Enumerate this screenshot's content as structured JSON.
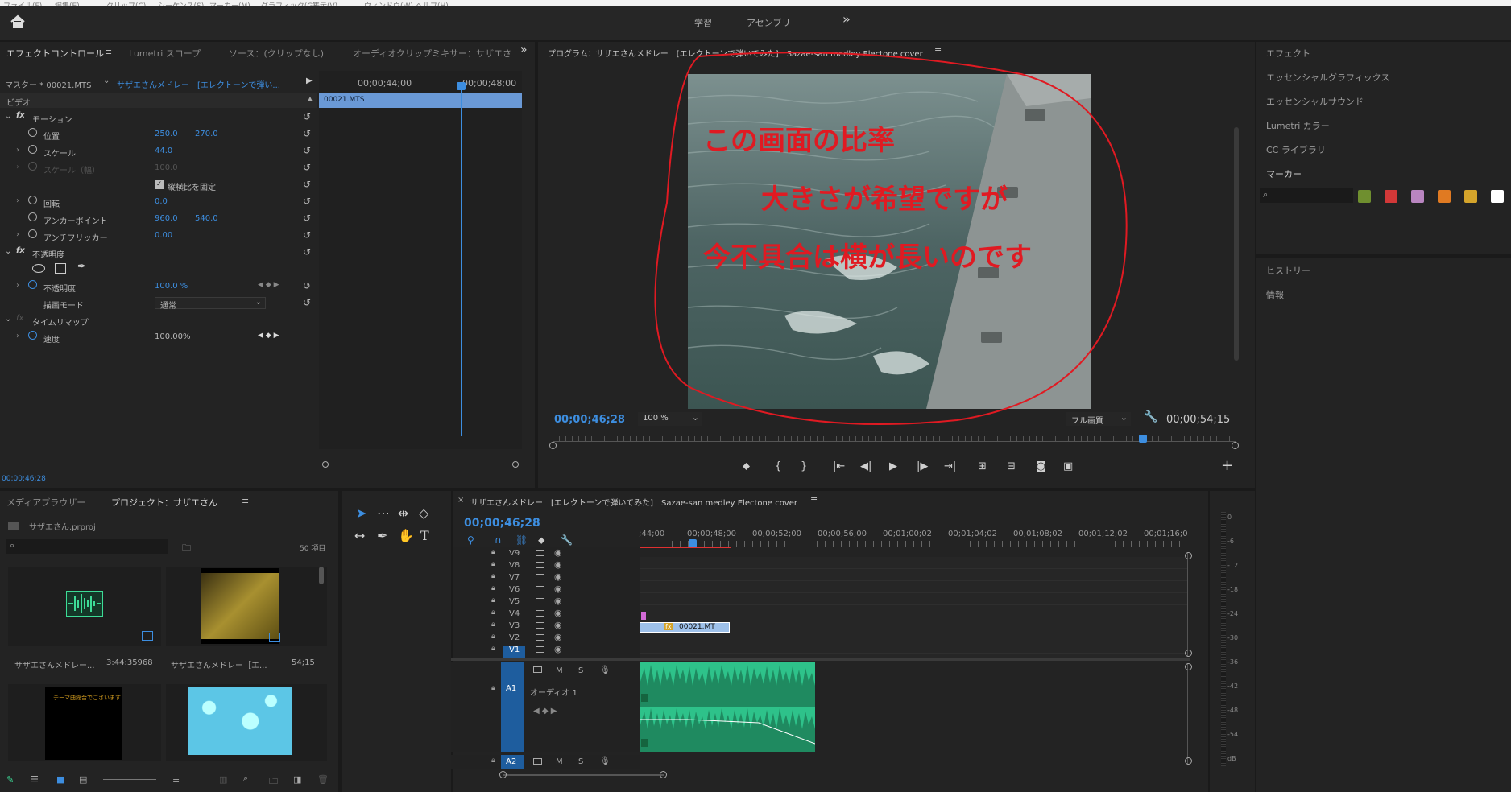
{
  "menubar": {
    "items": [
      "ファイル(F)",
      "編集(E)",
      "クリップ(C)",
      "シーケンス(S)",
      "マーカー(M)",
      "グラフィック(G)",
      "表示(V)",
      "ウィンドウ(W)",
      "ヘルプ(H)"
    ]
  },
  "workspace": {
    "learn": "学習",
    "assembly": "アセンブリ",
    "more": "»"
  },
  "effect_controls": {
    "tabs": [
      "エフェクトコントロール",
      "Lumetri スコープ",
      "ソース：(クリップなし)",
      "オーディオクリップミキサー：サザエさ"
    ],
    "master": "マスター * 00021.MTS",
    "sequence": "サザエさんメドレー　[エレクトーンで弾い...",
    "video_header": "ビデオ",
    "timecode_start": "00;00;44;00",
    "timecode_end": "00;00;48;00",
    "clip": "00021.MTS",
    "motion": "モーション",
    "position_label": "位置",
    "position_x": "250.0",
    "position_y": "270.0",
    "scale_label": "スケール",
    "scale_value": "44.0",
    "scale_w_label": "スケール（幅）",
    "scale_w_value": "100.0",
    "uniform_label": "縦横比を固定",
    "rotation_label": "回転",
    "rotation_value": "0.0",
    "anchor_label": "アンカーポイント",
    "anchor_x": "960.0",
    "anchor_y": "540.0",
    "flicker_label": "アンチフリッカー",
    "flicker_value": "0.00",
    "opacity_section": "不透明度",
    "opacity_label": "不透明度",
    "opacity_value": "100.0 %",
    "blend_label": "描画モード",
    "blend_value": "通常",
    "timeremap": "タイムリマップ",
    "speed_label": "速度",
    "speed_value": "100.00%",
    "bottom_tc": "00;00;46;28"
  },
  "program": {
    "title": "プログラム：サザエさんメドレー　[エレクトーンで弾いてみた]　Sazae-san medley Electone cover",
    "tc": "00;00;46;28",
    "zoom": "100 %",
    "quality": "フル画質",
    "duration": "00;00;54;15",
    "annotation": [
      "この画面の比率",
      "大きさが希望ですが",
      "今不具合は横が長いのです"
    ]
  },
  "right_panel": {
    "items": [
      "エフェクト",
      "エッセンシャルグラフィックス",
      "エッセンシャルサウンド",
      "Lumetri カラー",
      "CC ライブラリ",
      "マーカー"
    ],
    "history": "ヒストリー",
    "info": "情報",
    "swatches": [
      "#6f8f2f",
      "#d23838",
      "#b985c0",
      "#e07a22",
      "#d4a42b",
      "#ffffff"
    ]
  },
  "project": {
    "tabs": [
      "メディアブラウザー",
      "プロジェクト：サザエさん"
    ],
    "file": "サザエさん.prproj",
    "count": "50 項目",
    "items": [
      {
        "name": "サザエさんメドレー...",
        "dur": "3:44:35968"
      },
      {
        "name": "サザエさんメドレー［エ...",
        "dur": "54;15"
      }
    ],
    "black_text": "テーマ曲総合でございます"
  },
  "timeline": {
    "title": "サザエさんメドレー　[エレクトーンで弾いてみた]　Sazae-san medley Electone cover",
    "tc": "00;00;46;28",
    "ticks": [
      ";44;00",
      "00;00;48;00",
      "00;00;52;00",
      "00;00;56;00",
      "00;01;00;02",
      "00;01;04;02",
      "00;01;08;02",
      "00;01;12;02",
      "00;01;16;0"
    ],
    "video_tracks": [
      "V9",
      "V8",
      "V7",
      "V6",
      "V5",
      "V4",
      "V3",
      "V2",
      "V1"
    ],
    "clip_label": "00021.MT",
    "audio_a1": "A1",
    "audio_a1_name": "オーディオ 1",
    "audio_a2": "A2",
    "m": "M",
    "s": "S"
  },
  "meter": {
    "scale": [
      "0",
      "-6",
      "-12",
      "-18",
      "-24",
      "-30",
      "-36",
      "-42",
      "-48",
      "-54",
      "dB"
    ]
  }
}
